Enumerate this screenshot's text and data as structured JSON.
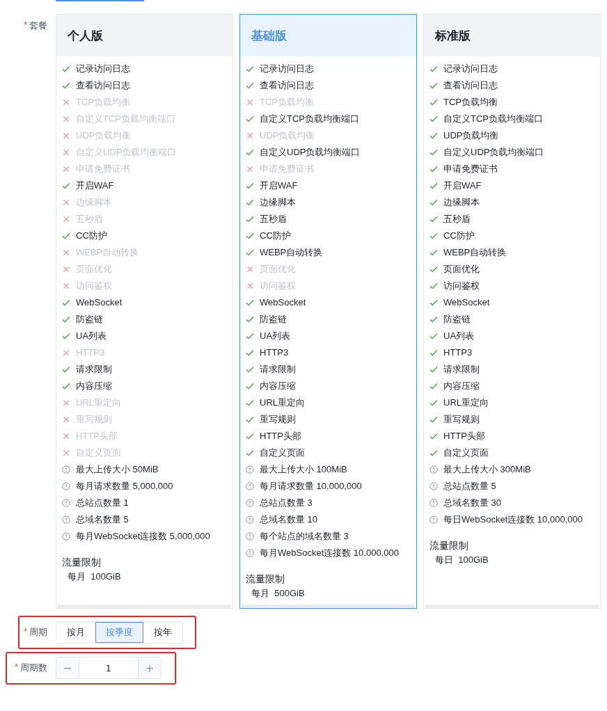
{
  "package_field": {
    "required_mark": "*",
    "label": "套餐"
  },
  "plans": [
    {
      "name": "个人版",
      "selected": false,
      "features": [
        {
          "label": "记录访问日志",
          "enabled": true
        },
        {
          "label": "查看访问日志",
          "enabled": true
        },
        {
          "label": "TCP负载均衡",
          "enabled": false
        },
        {
          "label": "自定义TCP负载均衡端口",
          "enabled": false
        },
        {
          "label": "UDP负载均衡",
          "enabled": false
        },
        {
          "label": "自定义UDP负载均衡端口",
          "enabled": false
        },
        {
          "label": "申请免费证书",
          "enabled": false
        },
        {
          "label": "开启WAF",
          "enabled": true
        },
        {
          "label": "边缘脚本",
          "enabled": false
        },
        {
          "label": "五秒盾",
          "enabled": false
        },
        {
          "label": "CC防护",
          "enabled": true
        },
        {
          "label": "WEBP自动转换",
          "enabled": false
        },
        {
          "label": "页面优化",
          "enabled": false
        },
        {
          "label": "访问鉴权",
          "enabled": false
        },
        {
          "label": "WebSocket",
          "enabled": true
        },
        {
          "label": "防盗链",
          "enabled": true
        },
        {
          "label": "UA列表",
          "enabled": true
        },
        {
          "label": "HTTP3",
          "enabled": false
        },
        {
          "label": "请求限制",
          "enabled": true
        },
        {
          "label": "内容压缩",
          "enabled": true
        },
        {
          "label": "URL重定向",
          "enabled": false
        },
        {
          "label": "重写规则",
          "enabled": false
        },
        {
          "label": "HTTP头部",
          "enabled": false
        },
        {
          "label": "自定义页面",
          "enabled": false
        }
      ],
      "limits": [
        "最大上传大小 50MiB",
        "每月请求数量 5,000,000",
        "总站点数量 1",
        "总域名数量 5",
        "每月WebSocket连接数 5,000,000"
      ],
      "traffic": {
        "title": "流量限制",
        "value": "每月  100GiB"
      }
    },
    {
      "name": "基础版",
      "selected": true,
      "features": [
        {
          "label": "记录访问日志",
          "enabled": true
        },
        {
          "label": "查看访问日志",
          "enabled": true
        },
        {
          "label": "TCP负载均衡",
          "enabled": false
        },
        {
          "label": "自定义TCP负载均衡端口",
          "enabled": true
        },
        {
          "label": "UDP负载均衡",
          "enabled": false
        },
        {
          "label": "自定义UDP负载均衡端口",
          "enabled": true
        },
        {
          "label": "申请免费证书",
          "enabled": false
        },
        {
          "label": "开启WAF",
          "enabled": true
        },
        {
          "label": "边缘脚本",
          "enabled": true
        },
        {
          "label": "五秒盾",
          "enabled": true
        },
        {
          "label": "CC防护",
          "enabled": true
        },
        {
          "label": "WEBP自动转换",
          "enabled": true
        },
        {
          "label": "页面优化",
          "enabled": false
        },
        {
          "label": "访问鉴权",
          "enabled": false
        },
        {
          "label": "WebSocket",
          "enabled": true
        },
        {
          "label": "防盗链",
          "enabled": true
        },
        {
          "label": "UA列表",
          "enabled": true
        },
        {
          "label": "HTTP3",
          "enabled": true
        },
        {
          "label": "请求限制",
          "enabled": true
        },
        {
          "label": "内容压缩",
          "enabled": true
        },
        {
          "label": "URL重定向",
          "enabled": true
        },
        {
          "label": "重写规则",
          "enabled": true
        },
        {
          "label": "HTTP头部",
          "enabled": true
        },
        {
          "label": "自定义页面",
          "enabled": true
        }
      ],
      "limits": [
        "最大上传大小 100MiB",
        "每月请求数量 10,000,000",
        "总站点数量 3",
        "总域名数量 10",
        "每个站点的域名数量 3",
        "每月WebSocket连接数 10,000,000"
      ],
      "traffic": {
        "title": "流量限制",
        "value": "每月  500GiB"
      }
    },
    {
      "name": "标准版",
      "selected": false,
      "features": [
        {
          "label": "记录访问日志",
          "enabled": true
        },
        {
          "label": "查看访问日志",
          "enabled": true
        },
        {
          "label": "TCP负载均衡",
          "enabled": true
        },
        {
          "label": "自定义TCP负载均衡端口",
          "enabled": true
        },
        {
          "label": "UDP负载均衡",
          "enabled": true
        },
        {
          "label": "自定义UDP负载均衡端口",
          "enabled": true
        },
        {
          "label": "申请免费证书",
          "enabled": true
        },
        {
          "label": "开启WAF",
          "enabled": true
        },
        {
          "label": "边缘脚本",
          "enabled": true
        },
        {
          "label": "五秒盾",
          "enabled": true
        },
        {
          "label": "CC防护",
          "enabled": true
        },
        {
          "label": "WEBP自动转换",
          "enabled": true
        },
        {
          "label": "页面优化",
          "enabled": true
        },
        {
          "label": "访问鉴权",
          "enabled": true
        },
        {
          "label": "WebSocket",
          "enabled": true
        },
        {
          "label": "防盗链",
          "enabled": true
        },
        {
          "label": "UA列表",
          "enabled": true
        },
        {
          "label": "HTTP3",
          "enabled": true
        },
        {
          "label": "请求限制",
          "enabled": true
        },
        {
          "label": "内容压缩",
          "enabled": true
        },
        {
          "label": "URL重定向",
          "enabled": true
        },
        {
          "label": "重写规则",
          "enabled": true
        },
        {
          "label": "HTTP头部",
          "enabled": true
        },
        {
          "label": "自定义页面",
          "enabled": true
        }
      ],
      "limits": [
        "最大上传大小 300MiB",
        "总站点数量 5",
        "总域名数量 30",
        "每日WebSocket连接数 10,000,000"
      ],
      "traffic": {
        "title": "流量限制",
        "value": "每日  100GiB"
      }
    }
  ],
  "period_field": {
    "required_mark": "*",
    "label": "周期",
    "options": [
      {
        "label": "按月",
        "selected": false
      },
      {
        "label": "按季度",
        "selected": true
      },
      {
        "label": "按年",
        "selected": false
      }
    ]
  },
  "count_field": {
    "required_mark": "*",
    "label": "周期数",
    "decrement": "−",
    "value": "1",
    "increment": "+"
  }
}
